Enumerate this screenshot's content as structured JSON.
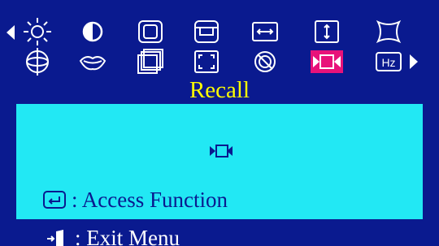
{
  "osd": {
    "title": "Recall",
    "colors": {
      "background": "#0a1a8f",
      "panel": "#22e8f4",
      "title": "#ffff00",
      "selected_icon_bg": "#e8127a",
      "icon_stroke": "#ffffff"
    },
    "navigation": {
      "left_icon": "triangle-left-icon",
      "right_icon": "triangle-right-icon"
    },
    "menu_icons": [
      {
        "name": "brightness-icon"
      },
      {
        "name": "contrast-icon"
      },
      {
        "name": "horizontal-position-icon"
      },
      {
        "name": "vertical-position-icon"
      },
      {
        "name": "horizontal-size-icon"
      },
      {
        "name": "vertical-size-icon"
      },
      {
        "name": "pincushion-icon"
      },
      {
        "name": "rotation-icon"
      },
      {
        "name": "trapezoid-icon"
      },
      {
        "name": "parallelogram-icon"
      },
      {
        "name": "zoom-icon"
      },
      {
        "name": "degauss-icon"
      },
      {
        "name": "recall-icon",
        "selected": true
      },
      {
        "name": "frequency-hz-icon",
        "text": "Hz"
      }
    ],
    "legend": {
      "access_label": ": Access Function",
      "exit_label": ": Exit Menu"
    }
  }
}
